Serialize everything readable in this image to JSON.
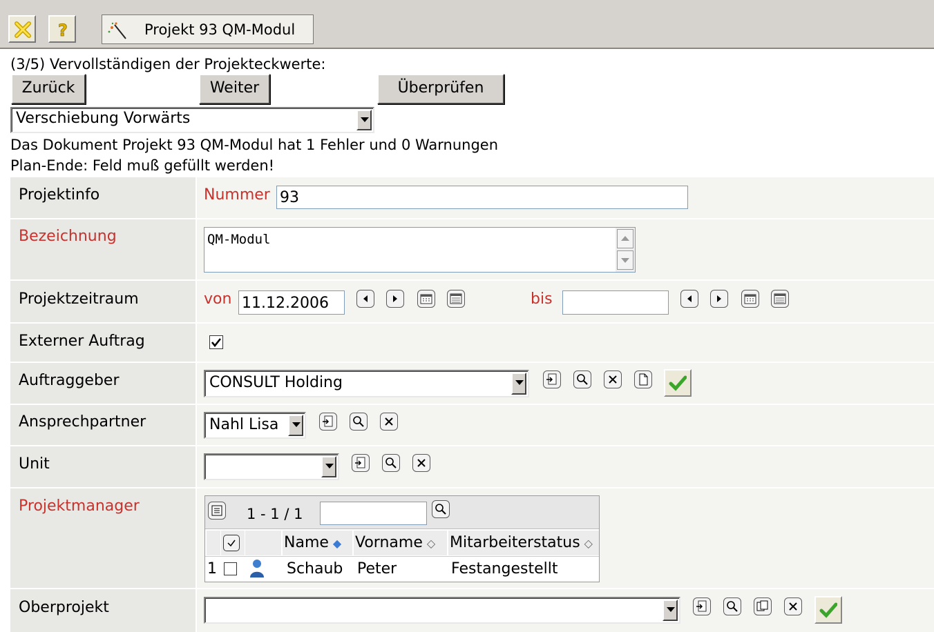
{
  "toolbar": {
    "close_icon": "close-icon",
    "help_icon": "help-icon",
    "tab_label": "Projekt 93 QM-Modul"
  },
  "wizard": {
    "step_text": "(3/5) Vervollständigen der Projekteckwerte:",
    "back_label": "Zurück",
    "next_label": "Weiter",
    "check_label": "Überprüfen",
    "action_select": "Verschiebung Vorwärts",
    "error_summary": "Das Dokument Projekt 93 QM-Modul hat 1 Fehler und 0 Warnungen",
    "error_detail": "Plan-Ende: Feld muß gefüllt werden!"
  },
  "form": {
    "projektinfo": {
      "label": "Projektinfo",
      "nummer_label": "Nummer",
      "nummer_value": "93"
    },
    "bezeichnung": {
      "label": "Bezeichnung",
      "value": "QM-Modul"
    },
    "zeitraum": {
      "label": "Projektzeitraum",
      "von_label": "von",
      "von_value": "11.12.2006",
      "bis_label": "bis",
      "bis_value": ""
    },
    "extern": {
      "label": "Externer Auftrag",
      "checked": true
    },
    "auftraggeber": {
      "label": "Auftraggeber",
      "value": "CONSULT Holding"
    },
    "ansprechpartner": {
      "label": "Ansprechpartner",
      "value": "Nahl Lisa"
    },
    "unit": {
      "label": "Unit",
      "value": ""
    },
    "projektmanager": {
      "label": "Projektmanager",
      "pager": "1 - 1 / 1",
      "filter_value": "",
      "columns": [
        "Name",
        "Vorname",
        "Mitarbeiterstatus"
      ],
      "rows": [
        {
          "index": "1",
          "name": "Schaub",
          "vorname": "Peter",
          "status": "Festangestellt"
        }
      ]
    },
    "oberprojekt": {
      "label": "Oberprojekt",
      "value": ""
    }
  },
  "colors": {
    "required_label": "#c8322d",
    "ok_check": "#3aa52a"
  }
}
